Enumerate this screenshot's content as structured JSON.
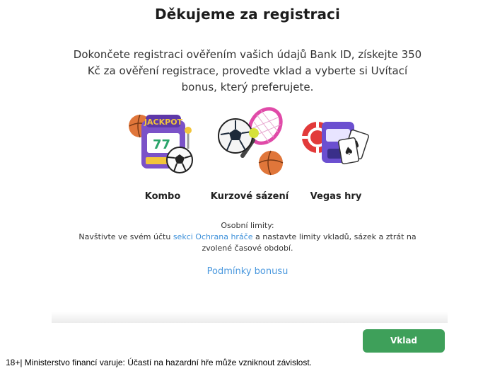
{
  "modal": {
    "title": "Děkujeme za registraci",
    "intro": "Dokončete registraci ověřením vašich údajů Bank ID, získejte 350 Kč za ověření registrace, proveďte vklad a vyberte si Uvítací bonus, který preferujete.",
    "cards": [
      {
        "label": "Kombo",
        "icon": "jackpot-slot-football-icon"
      },
      {
        "label": "Kurzové sázení",
        "icon": "sports-balls-racket-icon"
      },
      {
        "label": "Vegas hry",
        "icon": "casino-chips-cards-icon"
      }
    ],
    "limits": {
      "heading": "Osobní limity:",
      "text_before": "Navštivte ve svém účtu ",
      "link": "sekci Ochrana hráče",
      "text_after": " a nastavte limity vkladů, sázek a ztrát na zvolené časové období."
    },
    "terms_link": "Podmínky bonusu"
  },
  "deposit_button": "Vklad",
  "footer": "18+| Ministerstvo financí varuje: Účastí na hazardní hře může vzniknout závislost.",
  "colors": {
    "accent_green": "#3ea05a",
    "link_blue": "#3b8fd9"
  }
}
